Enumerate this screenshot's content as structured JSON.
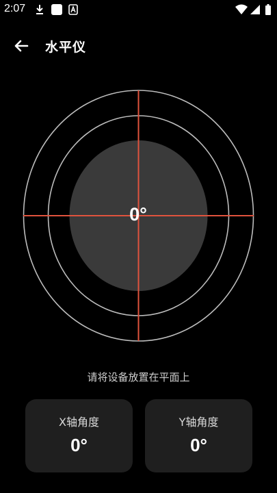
{
  "status_bar": {
    "time": "2:07",
    "icons": [
      "download-icon",
      "app-square-icon",
      "font-a-icon",
      "wifi-icon",
      "signal-icon",
      "battery-icon"
    ]
  },
  "app_bar": {
    "title": "水平仪",
    "back_icon": "arrow-left-icon"
  },
  "level": {
    "center_angle": "0°",
    "instruction": "请将设备放置在平面上",
    "crosshair_color": "#e0533d",
    "bubble_color": "#3a3a3a",
    "ring_color": "#bdbdbd"
  },
  "cards": {
    "x": {
      "label": "X轴角度",
      "value": "0°"
    },
    "y": {
      "label": "Y轴角度",
      "value": "0°"
    }
  }
}
